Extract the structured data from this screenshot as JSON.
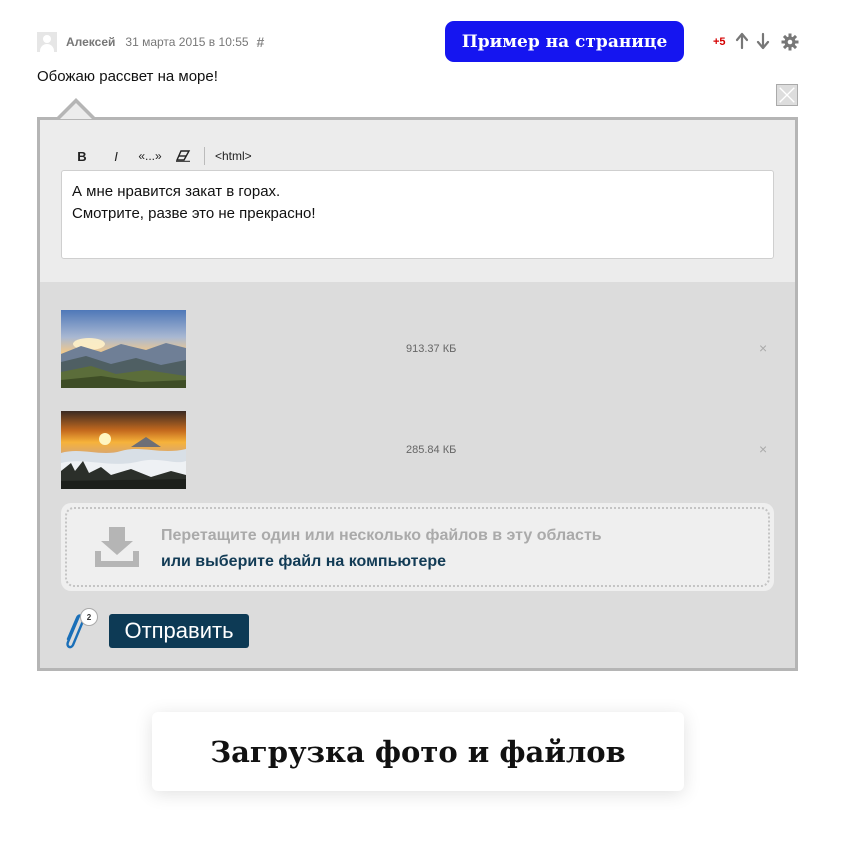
{
  "comment": {
    "author": "Алексей",
    "date": "31 марта 2015 в 10:55",
    "permalink_symbol": "#",
    "rating": "+5",
    "text": "Обожаю рассвет на море!"
  },
  "demo_button": {
    "label": "Пример на странице"
  },
  "editor": {
    "toolbar": {
      "bold": "B",
      "italic": "I",
      "quote": "«...»",
      "html": "<html>"
    },
    "text_lines": [
      "А мне нравится закат в горах.",
      "Смотрите, разве это не прекрасно!"
    ]
  },
  "attachments": [
    {
      "size": "913.37 КБ",
      "remove": "×",
      "thumb": "mountain-sunrise"
    },
    {
      "size": "285.84 КБ",
      "remove": "×",
      "thumb": "foggy-sunset"
    }
  ],
  "dropzone": {
    "hint": "Перетащите один или несколько файлов в эту область",
    "link": "или выберите файл на компьютере"
  },
  "attach_count": "2",
  "submit_label": "Отправить",
  "caption": "Загрузка фото и файлов",
  "colors": {
    "accent_blue": "#1515f0",
    "submit_bg": "#0d3a55",
    "rating_red": "#d40000",
    "clip_blue": "#1a6fb8"
  },
  "icons": {
    "vote_up": "arrow-up-icon",
    "vote_down": "arrow-down-icon",
    "settings": "gear-icon",
    "close": "close-icon",
    "eraser": "eraser-icon",
    "download": "download-icon",
    "paperclip": "paperclip-icon"
  }
}
